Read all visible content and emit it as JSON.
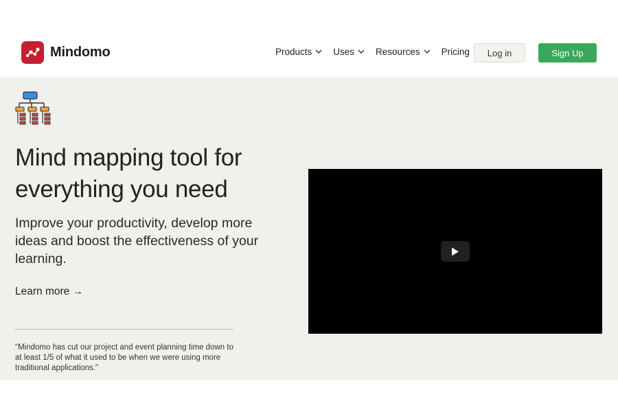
{
  "brand": {
    "name": "Mindomo",
    "logo_color": "#c42032",
    "logo_icon": "mindomo-logo-icon"
  },
  "nav": {
    "items": [
      {
        "label": "Products",
        "has_dropdown": true
      },
      {
        "label": "Uses",
        "has_dropdown": true
      },
      {
        "label": "Resources",
        "has_dropdown": true
      },
      {
        "label": "Pricing",
        "has_dropdown": false
      }
    ],
    "login_label": "Log in",
    "signup_label": "Sign Up",
    "signup_color": "#3aa85a"
  },
  "hero": {
    "icon": "org-chart-icon",
    "headline": "Mind mapping tool for everything you need",
    "subhead": "Improve your productivity, develop more ideas and boost the effectiveness of your learning.",
    "learn_more": "Learn more →",
    "quote": "\"Mindomo has cut our project and event planning time down to at least 1/5 of what it used to be when we were using more traditional applications.\"",
    "background": "#f0f0ec"
  },
  "video": {
    "icon": "play-icon"
  }
}
